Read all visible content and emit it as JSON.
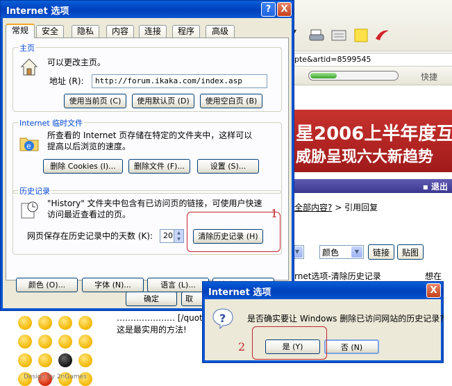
{
  "browser": {
    "address_fragment": "pte&artid=8599545",
    "quick_label": "快捷",
    "banner_line1": "星2006上半年度互",
    "banner_line2": "威胁呈现六大新趋势",
    "exit_label": "▪ 退出",
    "reply_line_link": "全部内容?",
    "reply_line_rest": "> 引用回复",
    "color_select": "颜色",
    "link_button": "链接",
    "paste_button": "贴图",
    "post_title": "rnet选项-清除历史记录",
    "post_right": "想在",
    "quote_line": "………………… [/quot",
    "best_line": "这是最实用的方法!",
    "design_credit": "Design by 2nGames",
    "progress_percent": 30,
    "accent": "#0a54d0"
  },
  "options_dialog": {
    "title": "Internet 选项",
    "help_btn": "?",
    "close_btn": "X",
    "tabs": [
      "常规",
      "安全",
      "隐私",
      "内容",
      "连接",
      "程序",
      "高级"
    ],
    "home": {
      "title": "主页",
      "desc": "可以更改主页。",
      "address_label": "地址 (R):",
      "address_value": "http://forum.ikaka.com/index.asp",
      "btn_current": "使用当前页 (C)",
      "btn_default": "使用默认页 (D)",
      "btn_blank": "使用空白页 (B)"
    },
    "temp": {
      "title": "Internet 临时文件",
      "desc": "所查看的 Internet 页存储在特定的文件夹中，这样可以提高以后浏览的速度。",
      "btn_cookies": "删除 Cookies (I)...",
      "btn_files": "删除文件 (F)...",
      "btn_settings": "设置 (S)..."
    },
    "history": {
      "title": "历史记录",
      "desc": "\"History\" 文件夹中包含有已访问页的链接，可使用户快速访问最近查看过的页。",
      "days_label": "网页保存在历史记录中的天数 (K):",
      "days_value": "20",
      "btn_clear": "清除历史记录 (H)"
    },
    "bottom_buttons": [
      "颜色 (O)...",
      "字体 (N)...",
      "语言 (L)...",
      "辅助功能 (E)..."
    ],
    "ok_label": "确定",
    "cancel_partial": "取"
  },
  "confirm_dialog": {
    "title": "Internet 选项",
    "close_btn": "X",
    "message": "是否确实要让 Windows 删除已访问网站的历史记录?",
    "yes_label": "是 (Y)",
    "no_label": "否 (N)"
  },
  "annotations": [
    "1",
    "2"
  ]
}
